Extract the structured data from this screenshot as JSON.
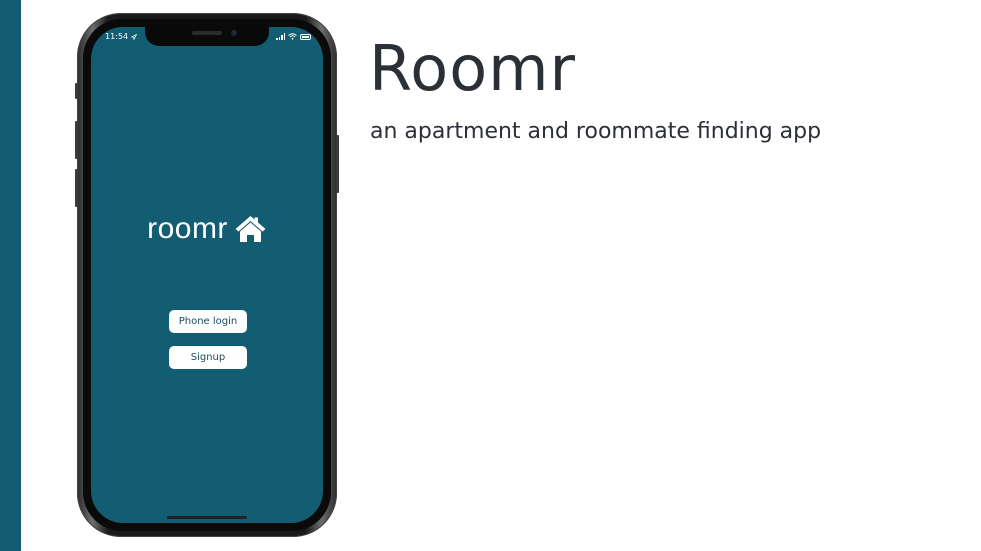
{
  "colors": {
    "accent": "#135d72",
    "screen_bg": "#135d72",
    "title_text": "#2b2f36",
    "button_bg": "#ffffff",
    "button_text": "#1a4b5e"
  },
  "slide": {
    "title": "Roomr",
    "subtitle": "an apartment and roommate finding app"
  },
  "phone": {
    "status_bar": {
      "time": "11:54",
      "icons": [
        "location-icon",
        "signal-icon",
        "wifi-icon",
        "battery-icon"
      ]
    },
    "app": {
      "logo_text": "roomr",
      "logo_icon": "house-icon",
      "buttons": {
        "phone_login": "Phone login",
        "signup": "Signup"
      }
    }
  }
}
